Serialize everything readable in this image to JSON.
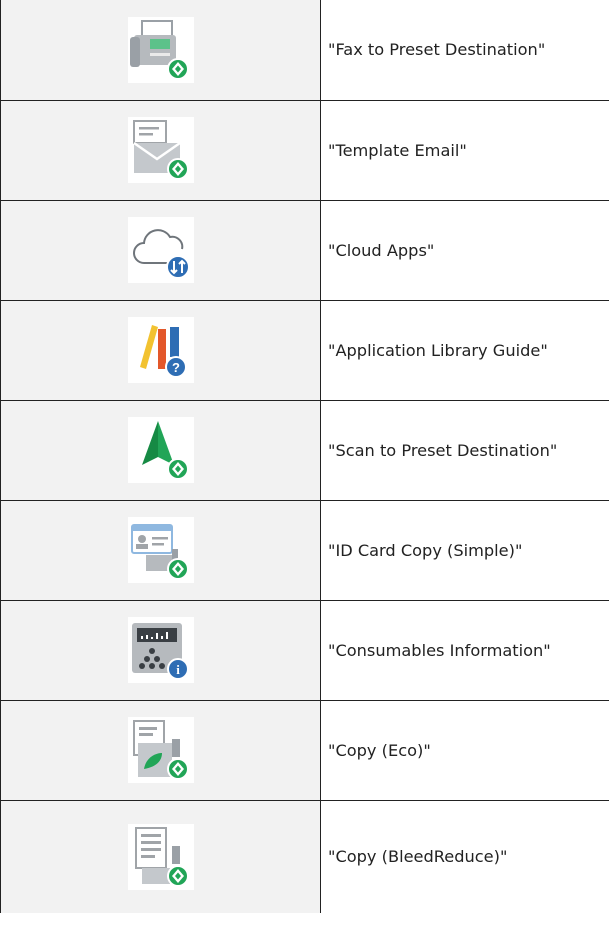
{
  "rows": [
    {
      "label": "\"Fax to Preset Destination\"",
      "icon": "fax-preset-icon"
    },
    {
      "label": "\"Template Email\"",
      "icon": "template-email-icon"
    },
    {
      "label": "\"Cloud Apps\"",
      "icon": "cloud-apps-icon"
    },
    {
      "label": "\"Application Library Guide\"",
      "icon": "library-guide-icon"
    },
    {
      "label": "\"Scan to Preset Destination\"",
      "icon": "scan-preset-icon"
    },
    {
      "label": "\"ID Card Copy (Simple)\"",
      "icon": "id-card-copy-icon"
    },
    {
      "label": "\"Consumables Information\"",
      "icon": "consumables-info-icon"
    },
    {
      "label": "\"Copy (Eco)\"",
      "icon": "copy-eco-icon"
    },
    {
      "label": "\"Copy (BleedReduce)\"",
      "icon": "copy-bleedreduce-icon"
    }
  ],
  "colors": {
    "preset_green": "#21a557",
    "info_blue": "#2e6db4",
    "icon_gray": "#a0a4a8",
    "cell_background": "#f2f2f2",
    "border": "#222222"
  }
}
